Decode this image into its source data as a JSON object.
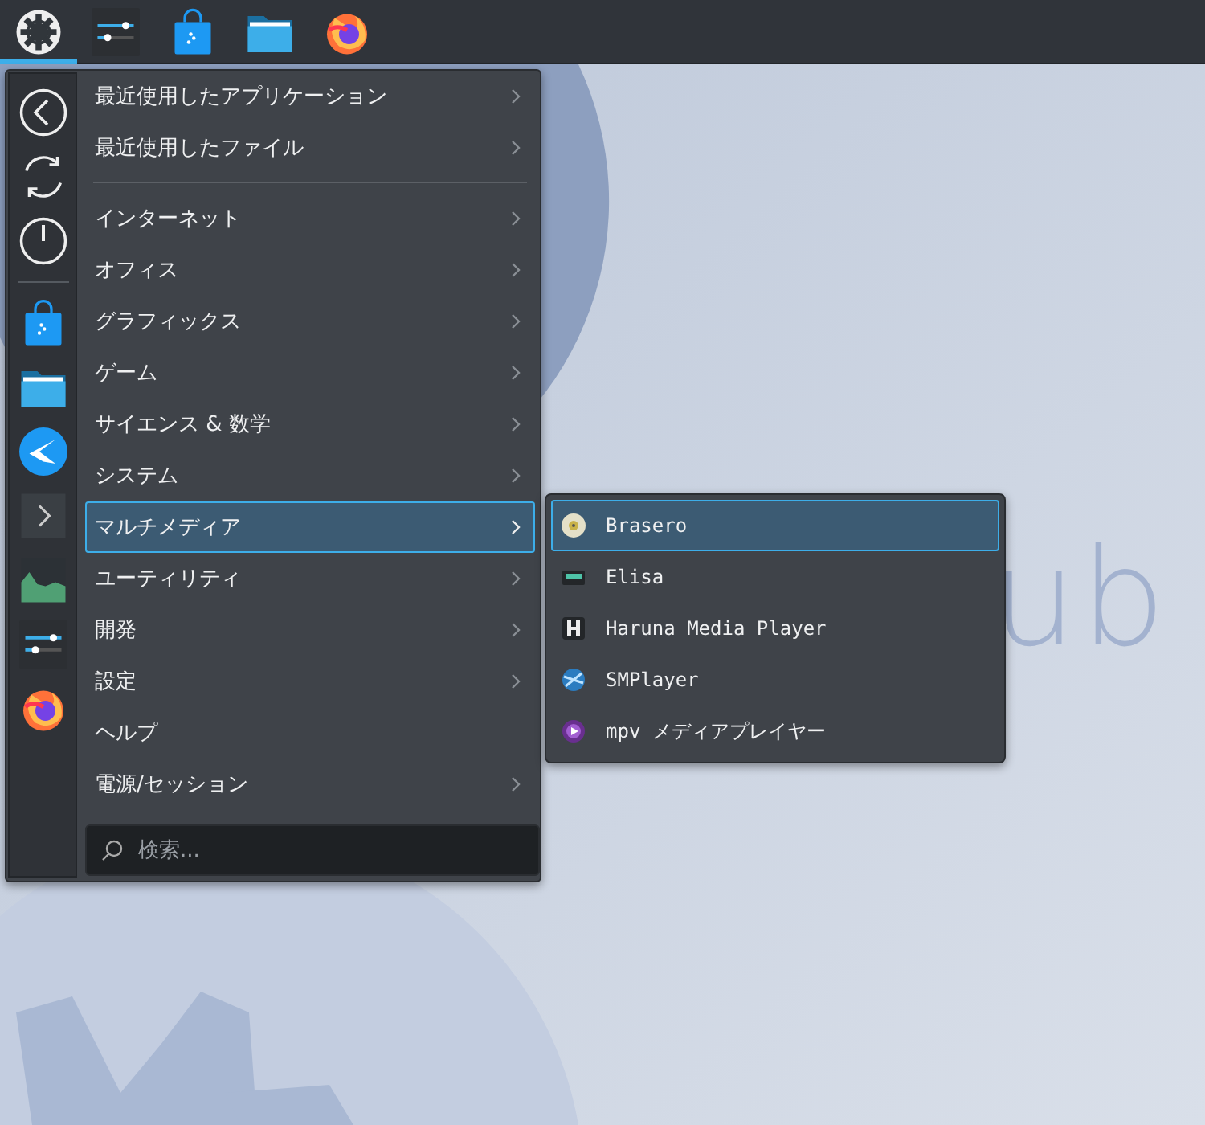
{
  "wallpaper": {
    "logo_text": "ub"
  },
  "taskbar": {
    "items": [
      {
        "kind": "launcher",
        "selected": true
      },
      {
        "kind": "settings",
        "selected": false
      },
      {
        "kind": "store",
        "selected": false
      },
      {
        "kind": "folder",
        "selected": false
      },
      {
        "kind": "browser",
        "selected": false
      }
    ]
  },
  "menu": {
    "favorites": [
      {
        "kind": "back"
      },
      {
        "kind": "refresh"
      },
      {
        "kind": "power"
      },
      {
        "kind": "separator"
      },
      {
        "kind": "store"
      },
      {
        "kind": "folder"
      },
      {
        "kind": "bird"
      },
      {
        "kind": "terminal"
      },
      {
        "kind": "monitor"
      },
      {
        "kind": "settings"
      },
      {
        "kind": "browser"
      }
    ],
    "categories": [
      {
        "kind": "category",
        "label": "最近使用したアプリケーション",
        "has_submenu": true,
        "selected": false
      },
      {
        "kind": "category",
        "label": "最近使用したファイル",
        "has_submenu": true,
        "selected": false
      },
      {
        "kind": "separator"
      },
      {
        "kind": "category",
        "label": "インターネット",
        "has_submenu": true,
        "selected": false
      },
      {
        "kind": "category",
        "label": "オフィス",
        "has_submenu": true,
        "selected": false
      },
      {
        "kind": "category",
        "label": "グラフィックス",
        "has_submenu": true,
        "selected": false
      },
      {
        "kind": "category",
        "label": "ゲーム",
        "has_submenu": true,
        "selected": false
      },
      {
        "kind": "category",
        "label": "サイエンス & 数学",
        "has_submenu": true,
        "selected": false
      },
      {
        "kind": "category",
        "label": "システム",
        "has_submenu": true,
        "selected": false
      },
      {
        "kind": "category",
        "label": "マルチメディア",
        "has_submenu": true,
        "selected": true
      },
      {
        "kind": "category",
        "label": "ユーティリティ",
        "has_submenu": true,
        "selected": false
      },
      {
        "kind": "category",
        "label": "開発",
        "has_submenu": true,
        "selected": false
      },
      {
        "kind": "category",
        "label": "設定",
        "has_submenu": true,
        "selected": false
      },
      {
        "kind": "category",
        "label": "ヘルプ",
        "has_submenu": false,
        "selected": false
      },
      {
        "kind": "category",
        "label": "電源/セッション",
        "has_submenu": true,
        "selected": false
      }
    ],
    "search": {
      "placeholder": "検索..."
    }
  },
  "submenu": {
    "items": [
      {
        "kind": "disc",
        "label": "Brasero",
        "selected": true
      },
      {
        "kind": "cassette",
        "label": "Elisa",
        "selected": false
      },
      {
        "kind": "letter-h",
        "label": "Haruna Media Player",
        "selected": false
      },
      {
        "kind": "globe",
        "label": "SMPlayer",
        "selected": false
      },
      {
        "kind": "play",
        "label": "mpv メディアプレイヤー",
        "selected": false
      }
    ]
  }
}
